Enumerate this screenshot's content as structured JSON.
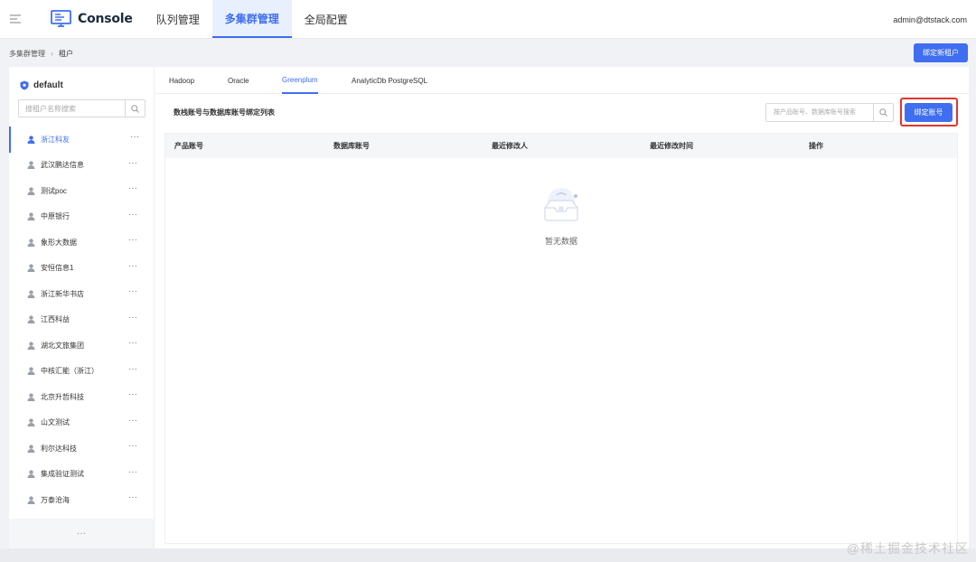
{
  "header": {
    "app_name": "Console",
    "nav": [
      {
        "label": "队列管理",
        "active": false
      },
      {
        "label": "多集群管理",
        "active": true
      },
      {
        "label": "全局配置",
        "active": false
      }
    ],
    "user": "admin@dtstack.com"
  },
  "breadcrumb": {
    "items": [
      "多集群管理",
      "租户"
    ]
  },
  "actions": {
    "bind_new_tenant": "绑定新租户"
  },
  "sidebar": {
    "title": "default",
    "search_placeholder": "搜租户名称搜索",
    "tenants": [
      {
        "name": "浙江科友",
        "active": true
      },
      {
        "name": "武汉鹏达信息",
        "active": false
      },
      {
        "name": "测试poc",
        "active": false
      },
      {
        "name": "中原银行",
        "active": false
      },
      {
        "name": "象形大数据",
        "active": false
      },
      {
        "name": "安恒信息1",
        "active": false
      },
      {
        "name": "浙江新华书店",
        "active": false
      },
      {
        "name": "江西科益",
        "active": false
      },
      {
        "name": "湖北文旅集团",
        "active": false
      },
      {
        "name": "中核汇能（浙江）",
        "active": false
      },
      {
        "name": "北京升哲科技",
        "active": false
      },
      {
        "name": "山文测试",
        "active": false
      },
      {
        "name": "利尔达科技",
        "active": false
      },
      {
        "name": "集成验证测试",
        "active": false
      },
      {
        "name": "万泰沧海",
        "active": false
      }
    ],
    "more_label": "···",
    "footer_label": "···"
  },
  "main": {
    "tabs": [
      {
        "label": "Hadoop",
        "active": false
      },
      {
        "label": "Oracle",
        "active": false
      },
      {
        "label": "Greenplum",
        "active": true
      },
      {
        "label": "AnalyticDb PostgreSQL",
        "active": false
      }
    ],
    "section_title": "数栈账号与数据库账号绑定列表",
    "search_placeholder": "按产品账号、数据库账号搜索",
    "bind_account_button": "绑定账号",
    "table": {
      "columns": [
        "产品账号",
        "数据库账号",
        "最近修改人",
        "最近修改时间",
        "操作"
      ],
      "rows": []
    },
    "empty_text": "暂无数据"
  },
  "watermark": "@稀土掘金技术社区",
  "colors": {
    "primary": "#3f6ef0",
    "highlight": "#e0362e",
    "background": "#f0f2f5"
  }
}
